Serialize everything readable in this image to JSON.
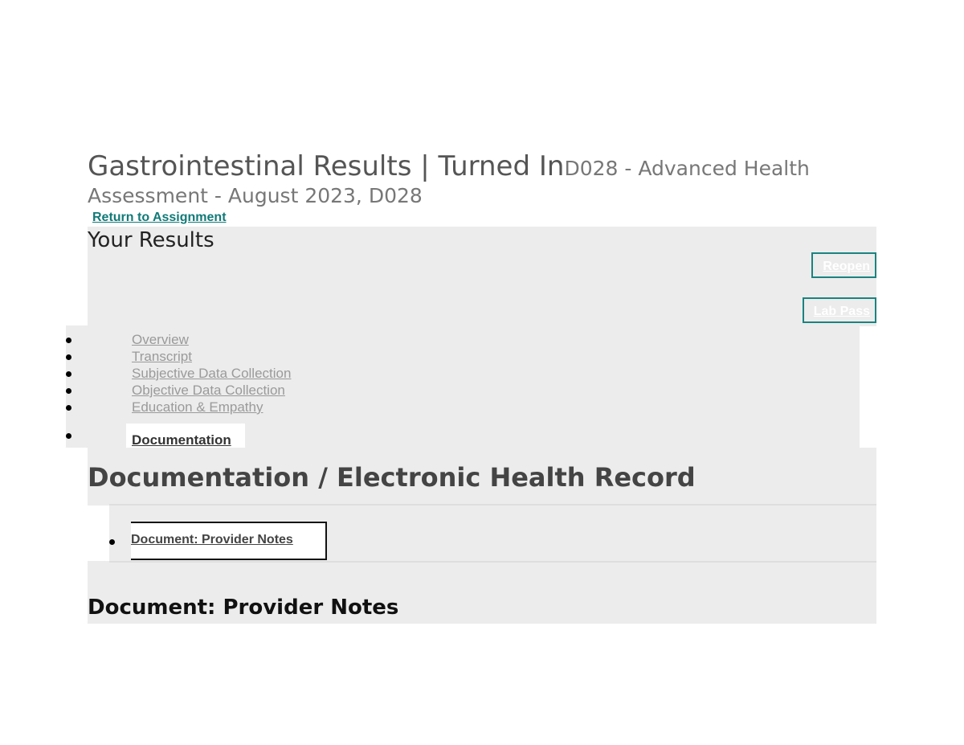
{
  "header": {
    "title": "Gastrointestinal Results | Turned In",
    "course_line1": "D028 - Advanced Health",
    "course_line2": "Assessment - August 2023, D028",
    "return_link": "Return to Assignment"
  },
  "results": {
    "title": "Your Results",
    "reopen_label": "Reopen",
    "lab_pass_label": "Lab Pass"
  },
  "nav": {
    "items": [
      {
        "label": "Overview"
      },
      {
        "label": "Transcript"
      },
      {
        "label": "Subjective Data Collection"
      },
      {
        "label": "Objective Data Collection"
      },
      {
        "label": "Education & Empathy"
      },
      {
        "label": "Documentation",
        "active": true
      }
    ]
  },
  "documentation": {
    "heading": "Documentation / Electronic Health Record",
    "tabs": [
      {
        "label": "Document: Provider Notes"
      }
    ],
    "section_title": "Document: Provider Notes"
  },
  "colors": {
    "accent": "#107a78",
    "panel_bg": "#ececec"
  }
}
